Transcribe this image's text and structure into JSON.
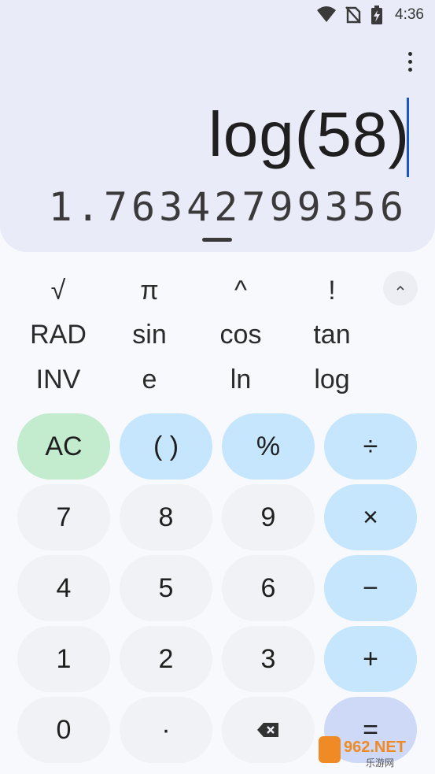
{
  "status_bar": {
    "time": "4:36"
  },
  "display": {
    "expression": "log(58)",
    "result": "1.76342799356"
  },
  "scientific": {
    "rows": [
      [
        "√",
        "π",
        "^",
        "!"
      ],
      [
        "RAD",
        "sin",
        "cos",
        "tan"
      ],
      [
        "INV",
        "e",
        "ln",
        "log"
      ]
    ]
  },
  "keypad": {
    "rows": [
      [
        "AC",
        "( )",
        "%",
        "÷"
      ],
      [
        "7",
        "8",
        "9",
        "×"
      ],
      [
        "4",
        "5",
        "6",
        "−"
      ],
      [
        "1",
        "2",
        "3",
        "+"
      ],
      [
        "0",
        "·",
        "backspace",
        "="
      ]
    ]
  },
  "watermark": {
    "text": "962.NET",
    "subtext": "乐游网"
  },
  "colors": {
    "display_bg": "#e9ecf8",
    "operator_bg": "#c5e6fc",
    "clear_bg": "#c3ebcd",
    "number_bg": "#f0f2f6",
    "equals_bg": "#cdd9f7",
    "cursor": "#1a56c4"
  }
}
